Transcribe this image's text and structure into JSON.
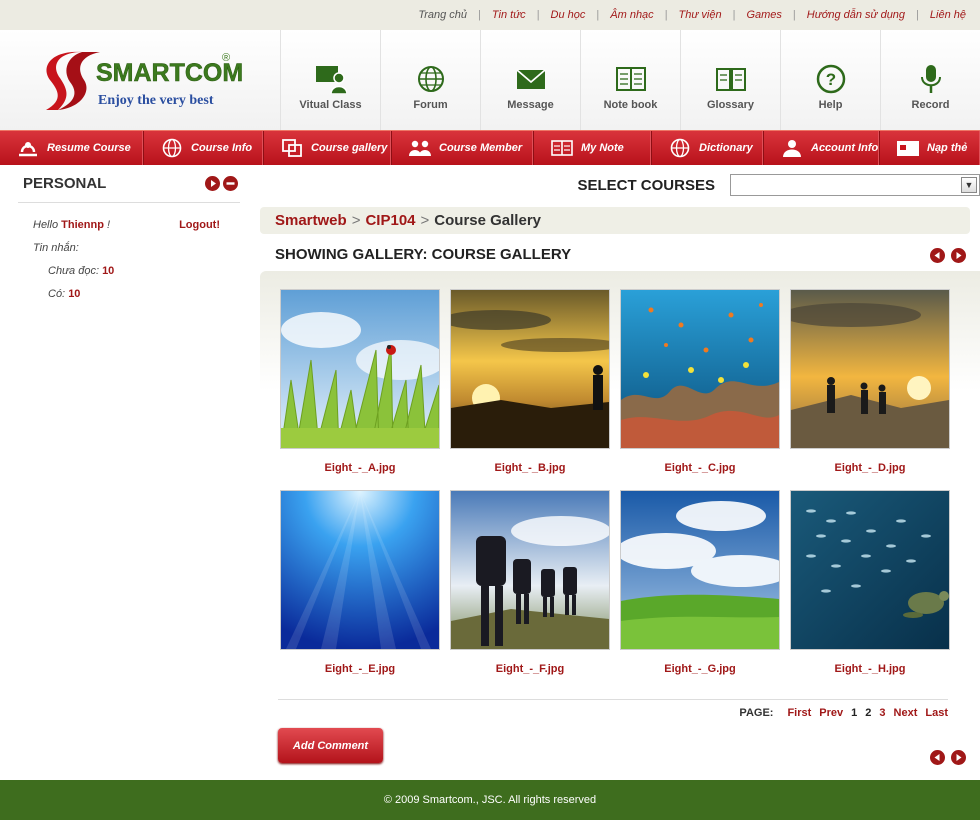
{
  "topnav": [
    "Trang chủ",
    "Tin tức",
    "Du học",
    "Âm nhạc",
    "Thư viện",
    "Games",
    "Hướng dẫn sử dụng",
    "Liên hệ"
  ],
  "logo": {
    "brand": "SMARTCOM",
    "tagline": "Enjoy the very best",
    "mark": "®"
  },
  "nav_icons": [
    {
      "label": "Vitual Class",
      "icon": "virtual-class-icon"
    },
    {
      "label": "Forum",
      "icon": "globe-icon"
    },
    {
      "label": "Message",
      "icon": "envelope-icon"
    },
    {
      "label": "Note book",
      "icon": "notebook-icon"
    },
    {
      "label": "Glossary",
      "icon": "book-icon"
    },
    {
      "label": "Help",
      "icon": "help-icon"
    },
    {
      "label": "Record",
      "icon": "microphone-icon"
    }
  ],
  "menu": [
    {
      "label": "Resume Course",
      "icon": "resume-icon"
    },
    {
      "label": "Course Info",
      "icon": "globe-icon"
    },
    {
      "label": "Course gallery",
      "icon": "gallery-icon"
    },
    {
      "label": "Course Member",
      "icon": "members-icon"
    },
    {
      "label": "My Note",
      "icon": "note-icon"
    },
    {
      "label": "Dictionary",
      "icon": "globe-icon"
    },
    {
      "label": "Account Info",
      "icon": "account-icon"
    },
    {
      "label": "Nạp thẻ",
      "icon": "card-icon"
    }
  ],
  "sidebar": {
    "title": "PERSONAL",
    "hello": "Hello",
    "username": "Thiennp",
    "bang": "!",
    "logout": "Logout!",
    "messages_label": "Tin nhắn:",
    "unread_label": "Chưa đọc:",
    "unread_count": "10",
    "total_label": "Có:",
    "total_count": "10"
  },
  "select_courses": {
    "label": "SELECT COURSES",
    "value": ""
  },
  "breadcrumb": {
    "site": "Smartweb",
    "course": "CIP104",
    "sep": ">",
    "current": "Course Gallery"
  },
  "gallery": {
    "title": "SHOWING GALLERY: COURSE GALLERY",
    "items": [
      {
        "caption": "Eight_-_A.jpg"
      },
      {
        "caption": "Eight_-_B.jpg"
      },
      {
        "caption": "Eight_-_C.jpg"
      },
      {
        "caption": "Eight_-_D.jpg"
      },
      {
        "caption": "Eight_-_E.jpg"
      },
      {
        "caption": "Eight_-_F.jpg"
      },
      {
        "caption": "Eight_-_G.jpg"
      },
      {
        "caption": "Eight_-_H.jpg"
      }
    ]
  },
  "pager": {
    "label": "PAGE:",
    "first": "First",
    "prev": "Prev",
    "pages": [
      "1",
      "2",
      "3"
    ],
    "next": "Next",
    "last": "Last"
  },
  "add_comment": "Add Comment",
  "footer": "© 2009 Smartcom., JSC. All rights reserved",
  "colors": {
    "brand_red": "#b8121b",
    "link_red": "#a01818",
    "footer_green": "#3e6d1e"
  }
}
